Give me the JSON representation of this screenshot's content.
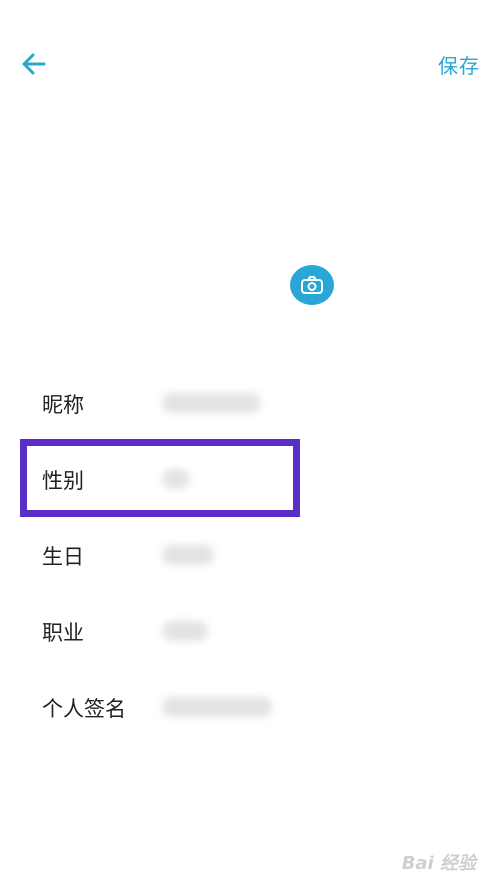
{
  "header": {
    "save_label": "保存"
  },
  "profile": {
    "fields": [
      {
        "label": "昵称"
      },
      {
        "label": "性别"
      },
      {
        "label": "生日"
      },
      {
        "label": "职业"
      },
      {
        "label": "个人签名"
      }
    ]
  },
  "colors": {
    "accent": "#2aa6d6",
    "highlight": "#5b2ec7"
  },
  "icons": {
    "back": "arrow-left-icon",
    "camera": "camera-icon"
  },
  "watermark": {
    "text": "Bai 经验"
  }
}
